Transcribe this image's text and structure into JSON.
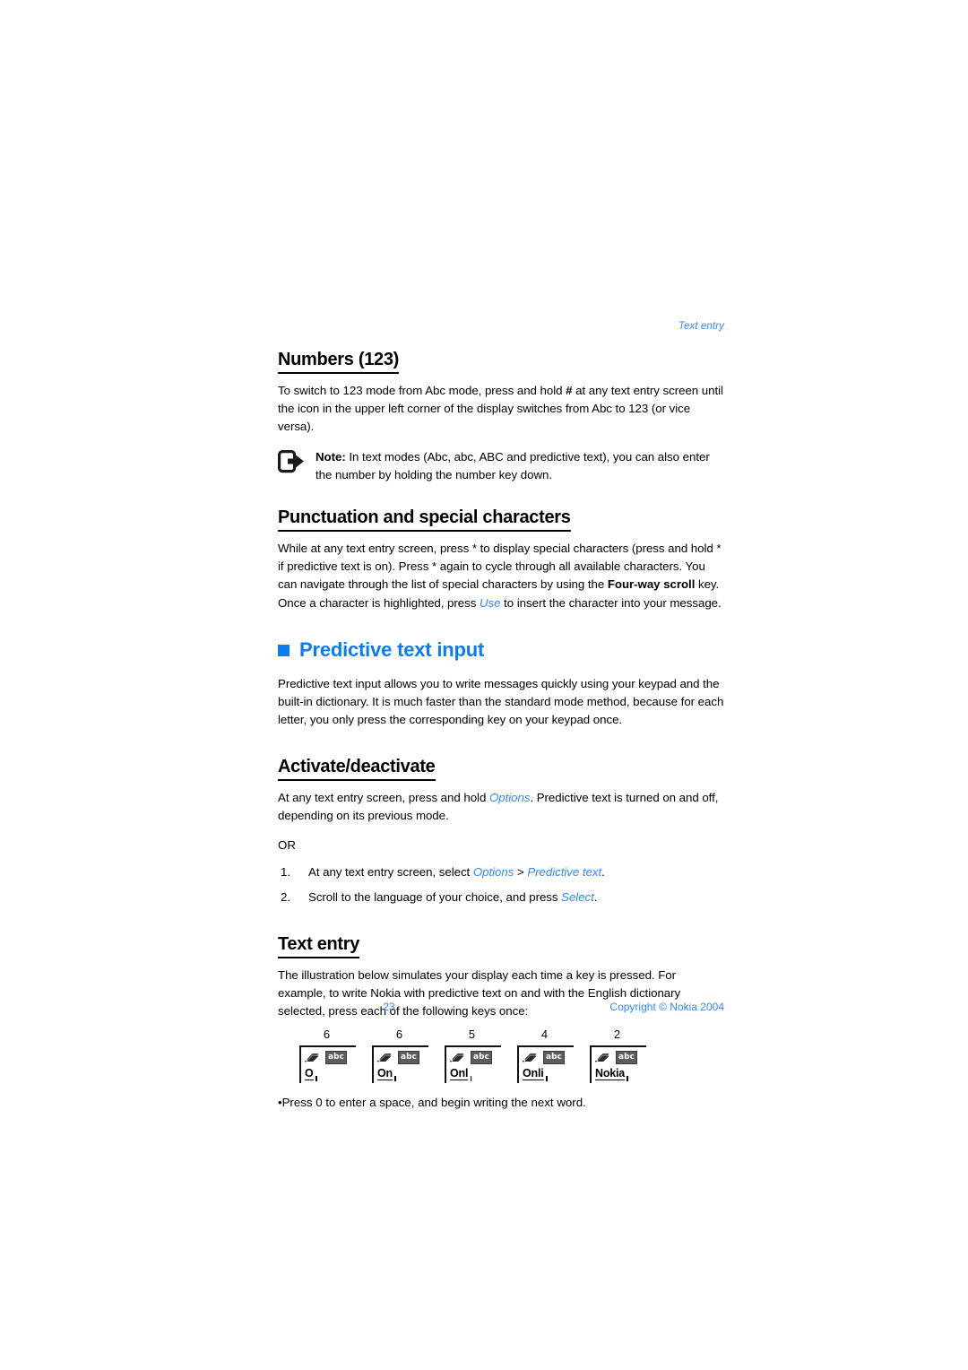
{
  "header": {
    "running_head": "Text entry"
  },
  "sections": {
    "numbers": {
      "heading": "Numbers (123)",
      "body": "To switch to 123 mode from Abc mode, press and hold # at any text entry screen until the icon in the upper left corner of the display switches from Abc to 123 (or vice versa).",
      "body_parts": {
        "p1": "To switch to 123 mode from Abc mode, press and hold ",
        "hash": "#",
        "p2": " at any text entry screen until the icon in the upper left corner of the display switches from Abc to 123 (or vice versa)."
      },
      "note": {
        "label": "Note:",
        "text": " In text modes (Abc, abc, ABC and predictive text), you can also enter the number by holding the number key down.",
        "icon": "note-arrow-icon"
      }
    },
    "punctuation": {
      "heading": "Punctuation and special characters",
      "body_parts": {
        "p1": "While at any text entry screen, press * to display special characters (press and hold * if predictive text is on). Press * again to cycle through all available characters. You can navigate through the list of special characters by using the ",
        "bold1": "Four-way scroll",
        "p2": " key. Once a character is highlighted, press ",
        "link1": "Use",
        "p3": " to insert the character into your message."
      }
    },
    "predictive": {
      "heading": "Predictive text input",
      "bullet_color": "#0a7cf0",
      "body": "Predictive text input allows you to write messages quickly using your keypad and the built-in dictionary. It is much faster than the standard mode method, because for each letter, you only press the corresponding key on your keypad once."
    },
    "activate": {
      "heading": "Activate/deactivate",
      "body_parts": {
        "p1": "At any text entry screen, press and hold ",
        "link1": "Options",
        "p2": ". Predictive text is turned on and off, depending on its previous mode."
      },
      "or": "OR",
      "steps": [
        {
          "num": "1.",
          "p1": "At any text entry screen, select ",
          "link1": "Options",
          "p2": " > ",
          "link2": "Predictive text",
          "p3": "."
        },
        {
          "num": "2.",
          "p1": "Scroll to the language of your choice, and press ",
          "link1": "Select",
          "p2": "."
        }
      ]
    },
    "text_entry": {
      "heading": "Text entry",
      "body": "The illustration below simulates your display each time a key is pressed. For example, to write Nokia with predictive text on and with the English dictionary selected, press each of the following keys once:",
      "displays": [
        {
          "key": "6",
          "mode_badge": "abc",
          "word": "O"
        },
        {
          "key": "6",
          "mode_badge": "abc",
          "word": "On"
        },
        {
          "key": "5",
          "mode_badge": "abc",
          "word": "Onl"
        },
        {
          "key": "4",
          "mode_badge": "abc",
          "word": "Onli"
        },
        {
          "key": "2",
          "mode_badge": "abc",
          "word": "Nokia"
        }
      ],
      "bullet_note": "Press 0 to enter a space, and begin writing the next word."
    }
  },
  "footer": {
    "page_number": "23",
    "copyright": "Copyright © Nokia 2004"
  }
}
